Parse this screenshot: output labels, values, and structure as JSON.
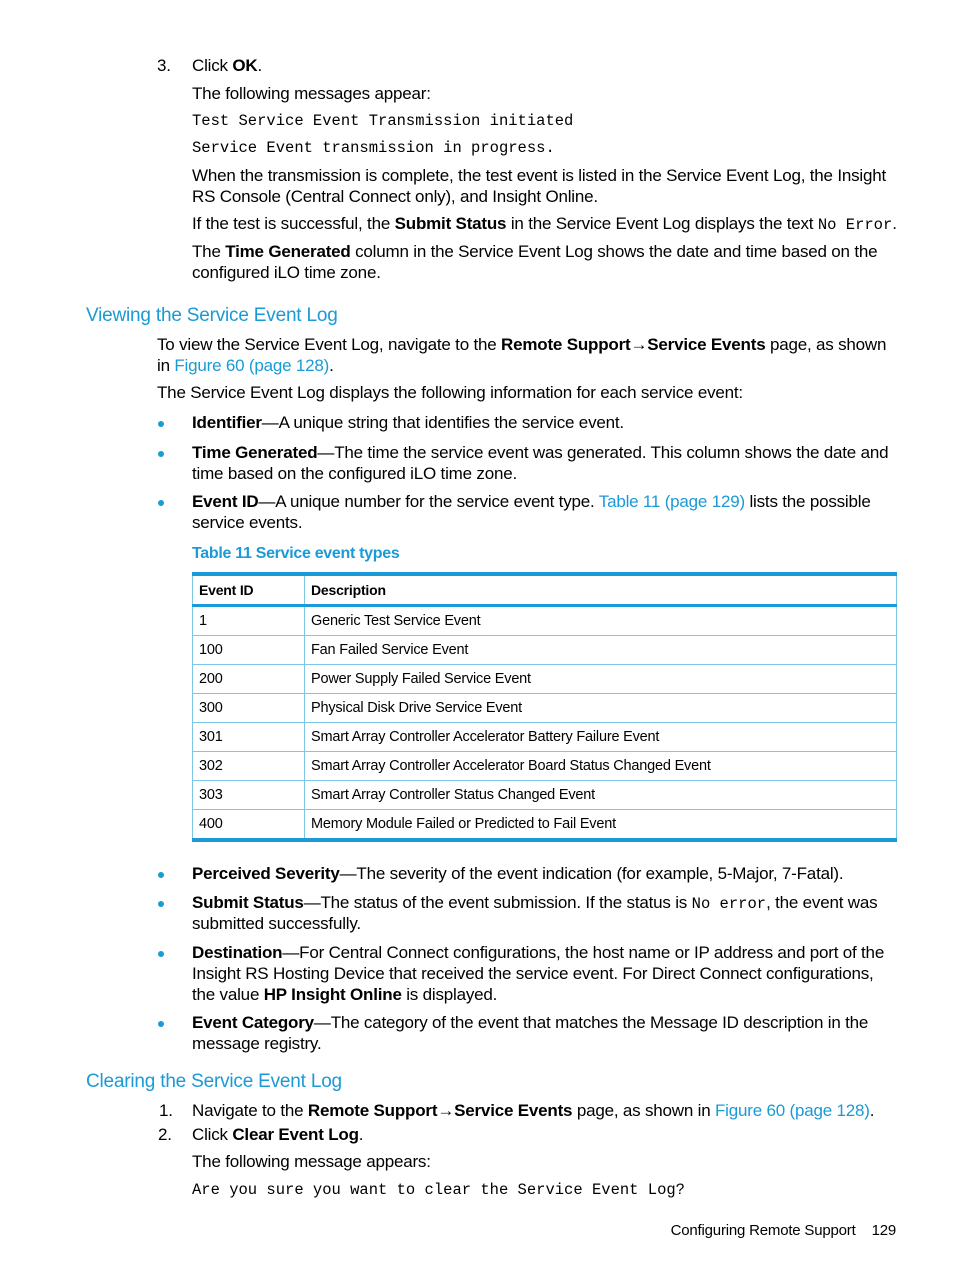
{
  "step3": {
    "number": "3.",
    "text_prefix": "Click ",
    "bold": "OK",
    "text_suffix": ".",
    "messages_intro": "The following messages appear:",
    "messages": [
      "Test Service Event Transmission initiated",
      "Service Event transmission in progress."
    ],
    "para1_line1": "When the transmission is complete, the test event is listed in the Service Event Log, the Insight",
    "para1_line2": "RS Console (Central Connect only), and Insight Online.",
    "para2_prefix": "If the test is successful, the ",
    "para2_bold": "Submit Status",
    "para2_middle": " in the Service Event Log displays the text ",
    "para2_code": "No Error",
    "para2_suffix": ".",
    "para3_prefix": "The ",
    "para3_bold": "Time Generated",
    "para3_line1_rest": " column in the Service Event Log shows the date and time based on the",
    "para3_line2": "configured iLO time zone."
  },
  "viewing": {
    "heading": "Viewing the Service Event Log",
    "intro_prefix": "To view the Service Event Log, navigate to the ",
    "intro_bold1": "Remote Support",
    "arrow": "→",
    "intro_bold2": "Service Events",
    "intro_suffix": " page, as shown",
    "intro_line2_prefix": "in ",
    "intro_link": "Figure 60 (page 128)",
    "intro_line2_suffix": ".",
    "lead": "The Service Event Log displays the following information for each service event:",
    "bullets_top": [
      {
        "term": "Identifier",
        "line1": "—A unique string that identifies the service event.",
        "line2": ""
      },
      {
        "term": "Time Generated",
        "line1": "—The time the service event was generated. This column shows the date and",
        "line2": "time based on the configured iLO time zone."
      },
      {
        "term": "Event ID",
        "line1_prefix": "—A unique number for the service event type. ",
        "link": "Table 11 (page 129)",
        "line1_suffix": " lists the possible",
        "line2": "service events."
      }
    ]
  },
  "table": {
    "caption": "Table 11 Service event types",
    "headers": [
      "Event ID",
      "Description"
    ],
    "rows": [
      [
        "1",
        "Generic Test Service Event"
      ],
      [
        "100",
        "Fan Failed Service Event"
      ],
      [
        "200",
        "Power Supply Failed Service Event"
      ],
      [
        "300",
        "Physical Disk Drive Service Event"
      ],
      [
        "301",
        "Smart Array Controller Accelerator Battery Failure Event"
      ],
      [
        "302",
        "Smart Array Controller Accelerator Board Status Changed Event"
      ],
      [
        "303",
        "Smart Array Controller Status Changed Event"
      ],
      [
        "400",
        "Memory Module Failed or Predicted to Fail Event"
      ]
    ]
  },
  "bullets_bottom": {
    "severity": {
      "term": "Perceived Severity",
      "text": "—The severity of the event indication (for example, 5-Major, 7-Fatal)."
    },
    "submit": {
      "term": "Submit Status",
      "text_prefix": "—The status of the event submission. If the status is ",
      "code": "No error",
      "text_suffix": ", the event was",
      "line2": "submitted successfully."
    },
    "destination": {
      "term": "Destination",
      "line1": "—For Central Connect configurations, the host name or IP address and port of the",
      "line2": "Insight RS Hosting Device that received the service event. For Direct Connect configurations,",
      "line3_prefix": "the value ",
      "line3_bold": "HP Insight Online",
      "line3_suffix": " is displayed."
    },
    "category": {
      "term": "Event Category",
      "line1": "—The category of the event that matches the Message ID description in the",
      "line2": "message registry."
    }
  },
  "clearing": {
    "heading": "Clearing the Service Event Log",
    "step1_number": "1.",
    "step1_prefix": "Navigate to the ",
    "step1_bold1": "Remote Support",
    "arrow": "→",
    "step1_bold2": "Service Events",
    "step1_middle": " page, as shown in ",
    "step1_link": "Figure 60 (page 128)",
    "step1_suffix": ".",
    "step2_number": "2.",
    "step2_prefix": "Click ",
    "step2_bold": "Clear Event Log",
    "step2_suffix": ".",
    "message_intro": "The following message appears:",
    "message": "Are you sure you want to clear the Service Event Log?"
  },
  "footer": {
    "section": "Configuring Remote Support",
    "page_number": "129"
  }
}
